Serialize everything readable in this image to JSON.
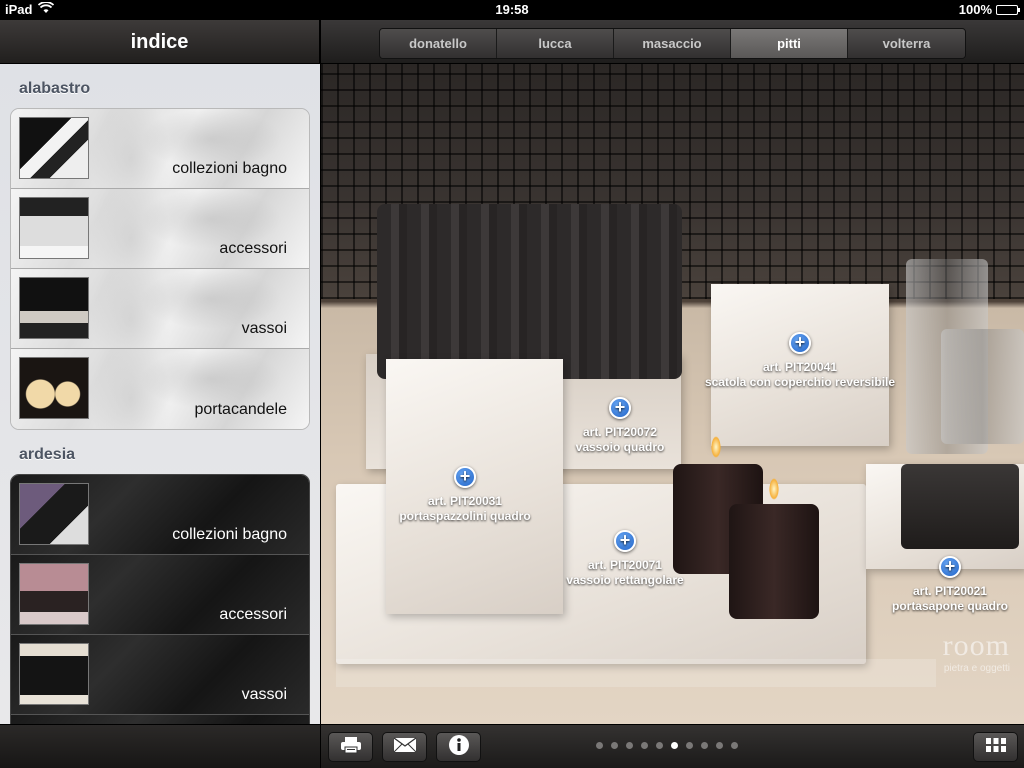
{
  "status": {
    "device": "iPad",
    "time": "19:58",
    "battery": "100%",
    "battery_level": 1.0
  },
  "sidebar": {
    "title": "indice",
    "sections": [
      {
        "title": "alabastro",
        "items": [
          {
            "label": "collezioni bagno"
          },
          {
            "label": "accessori"
          },
          {
            "label": "vassoi"
          },
          {
            "label": "portacandele"
          }
        ]
      },
      {
        "title": "ardesia",
        "items": [
          {
            "label": "collezioni bagno"
          },
          {
            "label": "accessori"
          },
          {
            "label": "vassoi"
          }
        ]
      }
    ]
  },
  "tabs": {
    "items": [
      "donatello",
      "lucca",
      "masaccio",
      "pitti",
      "volterra"
    ],
    "active": "pitti"
  },
  "products": [
    {
      "code": "art. PIT20041",
      "name": "scatola con coperchio reversibile"
    },
    {
      "code": "art. PIT20072",
      "name": "vassoio quadro"
    },
    {
      "code": "art. PIT20031",
      "name": "portaspazzolini quadro"
    },
    {
      "code": "art. PIT20071",
      "name": "vassoio rettangolare"
    },
    {
      "code": "art. PIT20021",
      "name": "portasapone quadro"
    }
  ],
  "watermark": {
    "brand": "room",
    "tagline": "pietra e oggetti"
  },
  "pager": {
    "count": 10,
    "current": 6
  },
  "icons": {
    "print": "printer-icon",
    "mail": "envelope-icon",
    "info": "info-icon",
    "grid": "grid-icon",
    "add": "plus-icon"
  }
}
